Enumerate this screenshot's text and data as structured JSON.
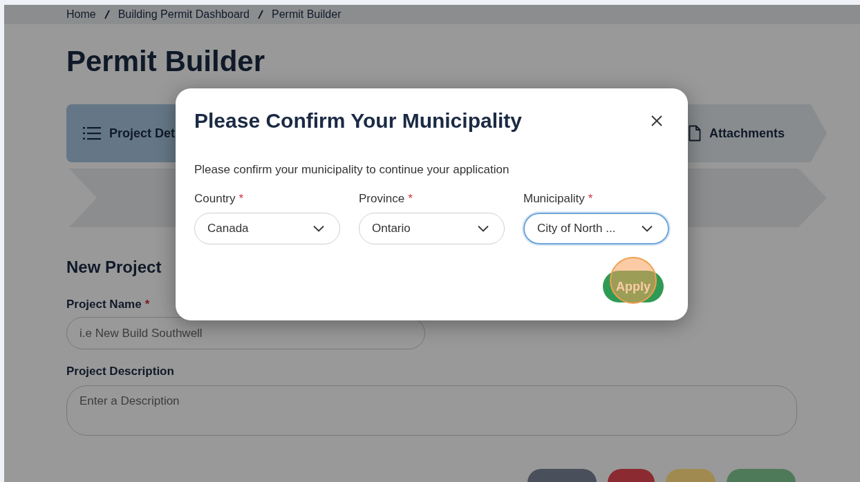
{
  "breadcrumb": [
    "Home",
    "Building Permit Dashboard",
    "Permit Builder"
  ],
  "page_title": "Permit Builder",
  "steps": [
    {
      "label": "Project Det",
      "selected": true
    },
    {
      "label": "Attachments",
      "selected": false
    }
  ],
  "section_title": "New Project",
  "fields": [
    {
      "label": "Project Name",
      "required_mark": "*",
      "placeholder": "i.e New Build Southwell",
      "kind": "input"
    },
    {
      "label": "Project Description",
      "placeholder": "Enter a Description",
      "kind": "textarea"
    }
  ],
  "footer_buttons": [
    {
      "color": "#4a4f5c"
    },
    {
      "color": "#8b2a30"
    },
    {
      "color": "#a08a50"
    },
    {
      "color": "#4f7a5a"
    }
  ],
  "modal": {
    "title": "Please Confirm Your Municipality",
    "message": "Please confirm your municipality to continue your application",
    "selects": [
      {
        "label": "Country",
        "required_mark": "*",
        "value": "Canada",
        "focused": false
      },
      {
        "label": "Province",
        "required_mark": "*",
        "value": "Ontario",
        "focused": false
      },
      {
        "label": "Municipality",
        "required_mark": "*",
        "value": "City of North ...",
        "focused": true
      }
    ],
    "apply_button": "Apply"
  }
}
